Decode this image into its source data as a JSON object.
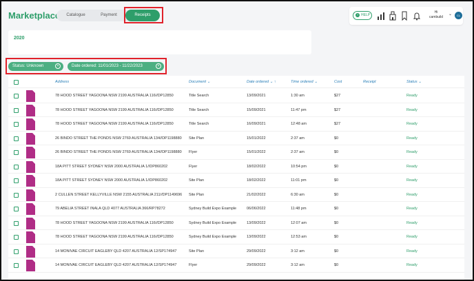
{
  "app": {
    "title": "Marketplace"
  },
  "tabs": [
    "Catalogue",
    "Payment",
    "Receipts"
  ],
  "help_label": "HELP",
  "user": {
    "greeting": "Hi",
    "name": "cambuild",
    "initials": "CL"
  },
  "year": "2020",
  "filters": [
    {
      "label": "Status: Unknown"
    },
    {
      "label": "Date ordered: 11/01/2023 - 11/22/2023"
    }
  ],
  "table": {
    "columns": [
      "Address",
      "Document",
      "Date ordered",
      "Time ordered",
      "Cost",
      "Receipt",
      "Status"
    ],
    "rows": [
      {
        "address": "78 HOOD STREET YAGOONA NSW 2199 AUSTRALIA 116//DP12850",
        "document": "Title Search",
        "date": "13/09/2021",
        "time": "1:30 am",
        "cost": "$27",
        "receipt": "",
        "status": "Ready"
      },
      {
        "address": "78 HOOD STREET YAGOONA NSW 2199 AUSTRALIA 116//DP12850",
        "document": "Title Search",
        "date": "15/09/2021",
        "time": "11:47 pm",
        "cost": "$27",
        "receipt": "",
        "status": "Ready"
      },
      {
        "address": "78 HOOD STREET YAGOONA NSW 2199 AUSTRALIA 116//DP12850",
        "document": "Title Search",
        "date": "16/09/2021",
        "time": "12:48 am",
        "cost": "$27",
        "receipt": "",
        "status": "Ready"
      },
      {
        "address": "26 BINDO STREET THE PONDS NSW 2769 AUSTRALIA 134//DP1198880",
        "document": "Site Plan",
        "date": "15/01/2022",
        "time": "2:37 am",
        "cost": "$0",
        "receipt": "",
        "status": "Ready"
      },
      {
        "address": "26 BINDO STREET THE PONDS NSW 2769 AUSTRALIA 134//DP1198880",
        "document": "Flyer",
        "date": "15/01/2022",
        "time": "2:37 am",
        "cost": "$0",
        "receipt": "",
        "status": "Ready"
      },
      {
        "address": "18A PITT STREET SYDNEY NSW 2000 AUSTRALIA 1//DP860202",
        "document": "Flyer",
        "date": "18/02/2022",
        "time": "10:54 pm",
        "cost": "$0",
        "receipt": "",
        "status": "Ready"
      },
      {
        "address": "18A PITT STREET SYDNEY NSW 2000 AUSTRALIA 1//DP860202",
        "document": "Site Plan",
        "date": "18/02/2022",
        "time": "11:01 pm",
        "cost": "$0",
        "receipt": "",
        "status": "Ready"
      },
      {
        "address": "2 CULLEN STREET KELLYVILLE NSW 2155 AUSTRALIA 211//DP1149696",
        "document": "Site Plan",
        "date": "21/02/2022",
        "time": "6:30 am",
        "cost": "$0",
        "receipt": "",
        "status": "Ready"
      },
      {
        "address": "79 ABELIA STREET INALA QLD 4077 AUSTRALIA 366/RP78272",
        "document": "Sydney Build Expo Example",
        "date": "06/06/2022",
        "time": "11:48 pm",
        "cost": "$0",
        "receipt": "",
        "status": "Ready"
      },
      {
        "address": "78 HOOD STREET YAGOONA NSW 2199 AUSTRALIA 116//DP12850",
        "document": "Sydney Build Expo Example",
        "date": "13/09/2022",
        "time": "12:07 am",
        "cost": "$0",
        "receipt": "",
        "status": "Ready"
      },
      {
        "address": "78 HOOD STREET YAGOONA NSW 2199 AUSTRALIA 116//DP12850",
        "document": "Sydney Build Expo Example",
        "date": "13/09/2022",
        "time": "12:53 am",
        "cost": "$0",
        "receipt": "",
        "status": "Ready"
      },
      {
        "address": "14 MONIVAE CIRCUIT EAGLEBY QLD 4207 AUSTRALIA 12/SP174947",
        "document": "Site Plan",
        "date": "29/09/2022",
        "time": "3:12 am",
        "cost": "$0",
        "receipt": "",
        "status": "Ready"
      },
      {
        "address": "14 MONIVAE CIRCUIT EAGLEBY QLD 4207 AUSTRALIA 12/SP174947",
        "document": "Flyer",
        "date": "29/09/2022",
        "time": "3:12 am",
        "cost": "$0",
        "receipt": "",
        "status": "Ready"
      }
    ]
  },
  "colors": {
    "brand": "#2e9e6a",
    "pdf": "#b02d86",
    "header_text": "#2a7fb8",
    "highlight": "#e0212a"
  }
}
